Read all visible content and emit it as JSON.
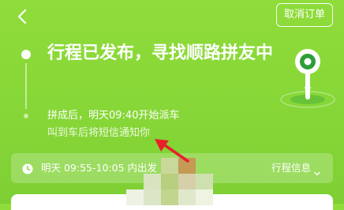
{
  "header": {
    "back_icon": "chevron-left-icon",
    "cancel_label": "取消订单"
  },
  "status": {
    "headline": "行程已发布，寻找顺路拼友中",
    "line1": "拼成后，明天09:40开始派车",
    "line2": "叫到车后将短信通知你"
  },
  "info_bar": {
    "clock_icon": "clock-icon",
    "departure": "明天 09:55-10:05 内出发",
    "trip_info_label": "行程信息"
  },
  "colors": {
    "background": "#86d637",
    "annotation_arrow": "#e8202a",
    "pin_dark": "#2e9e3a"
  }
}
